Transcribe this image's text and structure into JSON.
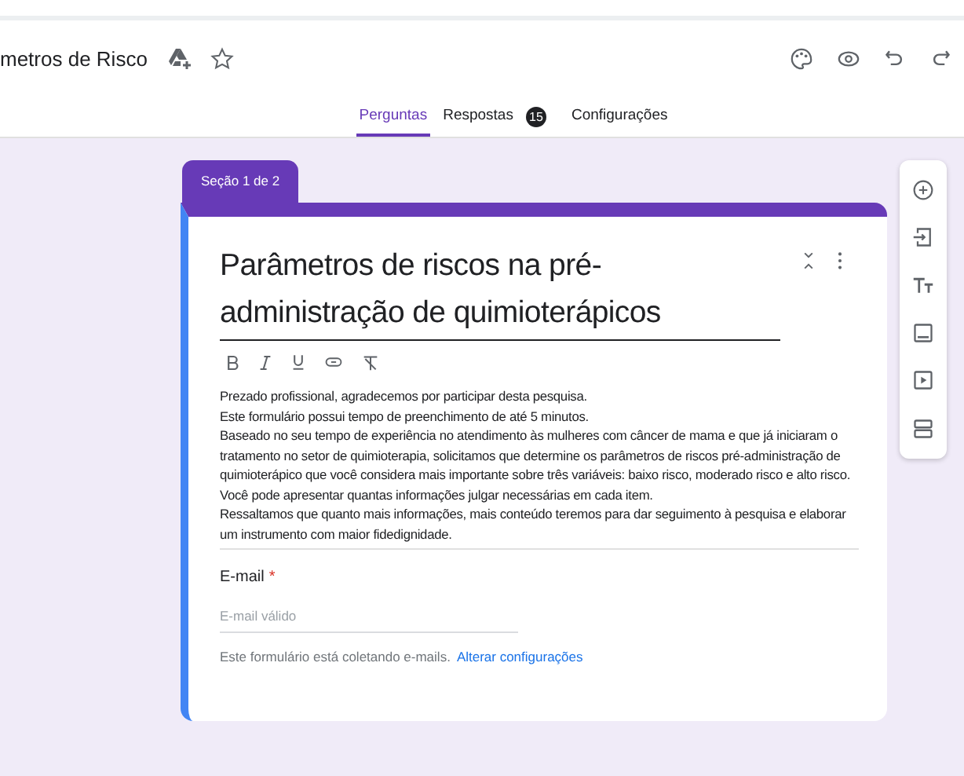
{
  "header": {
    "title": "metros de Risco"
  },
  "tabs": [
    {
      "label": "Perguntas",
      "selected": true
    },
    {
      "label": "Respostas",
      "selected": false,
      "badge": "15"
    },
    {
      "label": "Configurações",
      "selected": false
    }
  ],
  "section": {
    "label": "Seção 1 de 2",
    "title": "Parâmetros de riscos na pré-administração de quimioterápicos",
    "description": [
      "Prezado profissional, agradecemos por participar desta pesquisa.",
      "Este formulário possui tempo de preenchimento de até 5 minutos.",
      "Baseado no seu tempo de experiência no atendimento às mulheres com câncer de mama e que já iniciaram o tratamento no setor de quimioterapia, solicitamos que determine os parâmetros de riscos pré-administração de quimioterápico que você considera mais importante sobre três variáveis: baixo risco, moderado risco e alto risco. Você pode apresentar quantas informações julgar necessárias em cada item.",
      "Ressaltamos que quanto mais informações, mais conteúdo teremos para dar seguimento à pesquisa e elaborar um instrumento com maior fidedignidade."
    ]
  },
  "email": {
    "label": "E-mail",
    "required_mark": "*",
    "placeholder": "E-mail válido",
    "notice": "Este formulário está coletando e-mails.",
    "link": "Alterar configurações"
  }
}
